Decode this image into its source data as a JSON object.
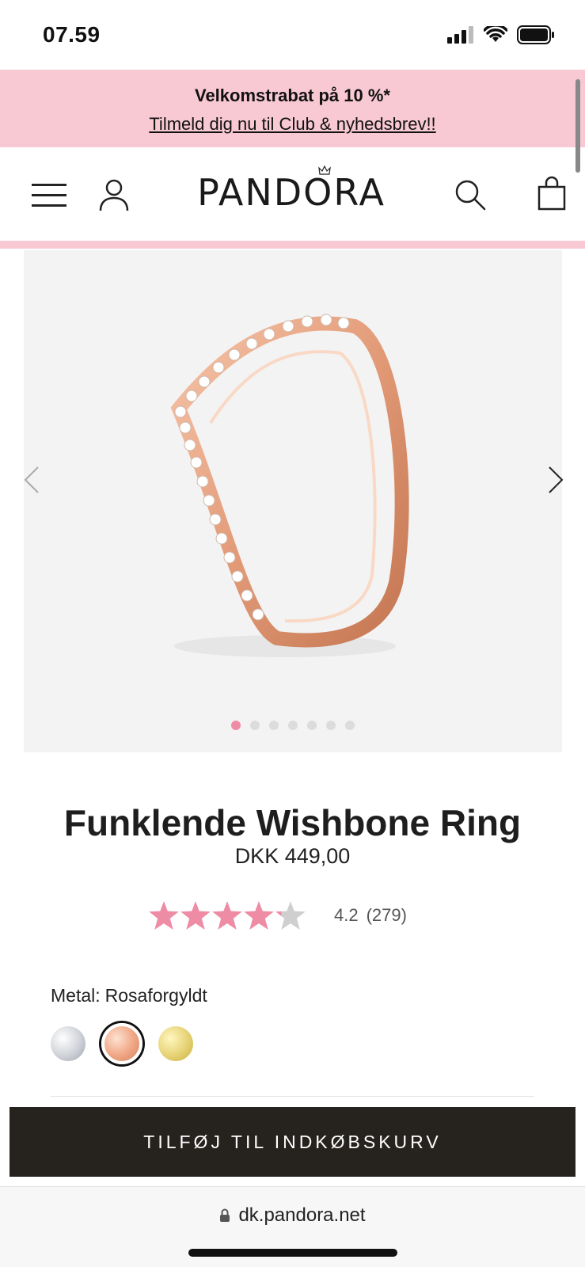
{
  "status_bar": {
    "time": "07.59"
  },
  "promo": {
    "title": "Velkomstrabat på 10 %*",
    "link": "Tilmeld dig nu til Club & nyhedsbrev!!"
  },
  "header": {
    "logo": "PANDORA"
  },
  "product": {
    "title": "Funklende Wishbone Ring",
    "price": "DKK 449,00",
    "rating_value": "4.2",
    "rating_count": "(279)",
    "rating": 4.2,
    "rating_max": 5,
    "metal_label": "Metal:",
    "metal_value": "Rosaforgyldt",
    "gallery_count": 7,
    "gallery_active": 1
  },
  "swatches": [
    {
      "name": "silver"
    },
    {
      "name": "rose",
      "selected": true
    },
    {
      "name": "gold"
    }
  ],
  "cta": {
    "add_to_cart": "TILFØJ TIL INDKØBSKURV"
  },
  "browser": {
    "url": "dk.pandora.net"
  },
  "colors": {
    "promo_pink": "#f8c8d3",
    "star_pink": "#ee8ca5",
    "button_dark": "#26231f"
  }
}
